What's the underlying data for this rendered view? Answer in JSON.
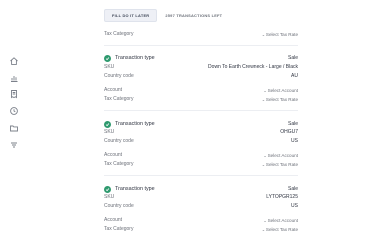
{
  "header": {
    "fill_later_button": "FILL DO IT LATER",
    "transactions_left": "2597 TRANSACTIONS LEFT"
  },
  "sidebar": {
    "icons": [
      "home-icon",
      "chart-icon",
      "receipt-icon",
      "clock-icon",
      "folder-icon",
      "filter-icon"
    ]
  },
  "top_partial": {
    "label": "Tax Category",
    "value": "Select Tax Rate"
  },
  "transactions": [
    {
      "type_label": "Transaction type",
      "type_value": "Sale",
      "sku_label": "SKU",
      "sku_value": "Down To Earth Crewneck - Large / Black",
      "country_label": "Country code",
      "country_value": "AU",
      "account_label": "Account",
      "account_value": "Select Account",
      "tax_label": "Tax Category",
      "tax_value": "Select Tax Rate"
    },
    {
      "type_label": "Transaction type",
      "type_value": "Sale",
      "sku_label": "SKU",
      "sku_value": "OHGU7",
      "country_label": "Country code",
      "country_value": "US",
      "account_label": "Account",
      "account_value": "Select Account",
      "tax_label": "Tax Category",
      "tax_value": "Select Tax Rate"
    },
    {
      "type_label": "Transaction type",
      "type_value": "Sale",
      "sku_label": "SKU",
      "sku_value": "LYTOPGR125",
      "country_label": "Country code",
      "country_value": "US",
      "account_label": "Account",
      "account_value": "Select Account",
      "tax_label": "Tax Category",
      "tax_value": "Select Tax Rate"
    }
  ]
}
